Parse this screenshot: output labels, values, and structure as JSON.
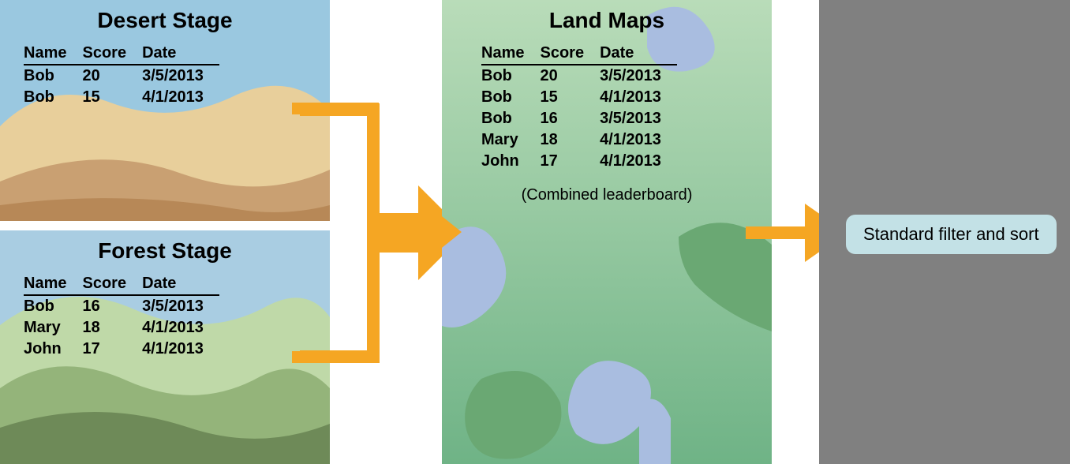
{
  "desert": {
    "title": "Desert Stage",
    "headers": [
      "Name",
      "Score",
      "Date"
    ],
    "rows": [
      [
        "Bob",
        "20",
        "3/5/2013"
      ],
      [
        "Bob",
        "15",
        "4/1/2013"
      ]
    ]
  },
  "forest": {
    "title": "Forest Stage",
    "headers": [
      "Name",
      "Score",
      "Date"
    ],
    "rows": [
      [
        "Bob",
        "16",
        "3/5/2013"
      ],
      [
        "Mary",
        "18",
        "4/1/2013"
      ],
      [
        "John",
        "17",
        "4/1/2013"
      ]
    ]
  },
  "land": {
    "title": "Land Maps",
    "headers": [
      "Name",
      "Score",
      "Date"
    ],
    "rows": [
      [
        "Bob",
        "20",
        "3/5/2013"
      ],
      [
        "Bob",
        "15",
        "4/1/2013"
      ],
      [
        "Bob",
        "16",
        "3/5/2013"
      ],
      [
        "Mary",
        "18",
        "4/1/2013"
      ],
      [
        "John",
        "17",
        "4/1/2013"
      ]
    ],
    "caption": "(Combined leaderboard)"
  },
  "callout": "Standard filter and sort",
  "colors": {
    "arrow": "#f5a623"
  }
}
